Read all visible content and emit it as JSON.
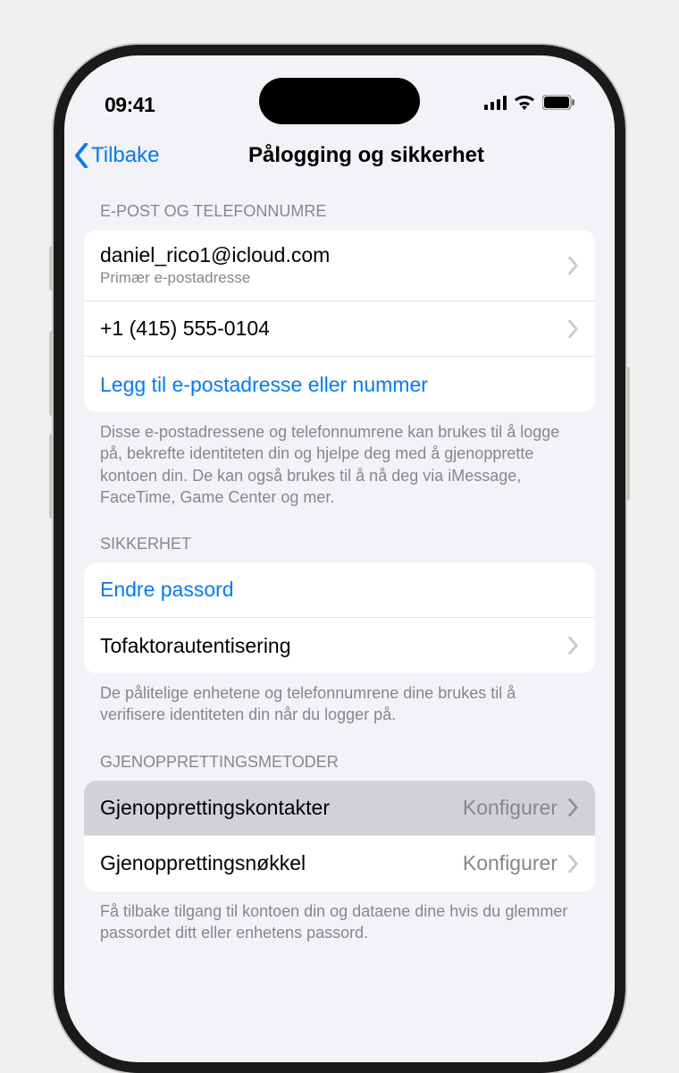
{
  "status_bar": {
    "time": "09:41"
  },
  "nav": {
    "back_label": "Tilbake",
    "title": "Pålogging og sikkerhet"
  },
  "sections": {
    "email_phone": {
      "header": "E-POST OG TELEFONNUMRE",
      "items": [
        {
          "title": "daniel_rico1@icloud.com",
          "subtitle": "Primær e-postadresse"
        },
        {
          "title": "+1 (415) 555-0104"
        }
      ],
      "add_link": "Legg til e-postadresse eller nummer",
      "footer": "Disse e-postadressene og telefonnumrene kan brukes til å logge på, bekrefte identiteten din og hjelpe deg med å gjenopprette kontoen din. De kan også brukes til å nå deg via iMessage, FaceTime, Game Center og mer."
    },
    "security": {
      "header": "SIKKERHET",
      "change_password": "Endre passord",
      "two_factor": "Tofaktorautentisering",
      "footer": "De pålitelige enhetene og telefonnumrene dine brukes til å verifisere identiteten din når du logger på."
    },
    "recovery": {
      "header": "GJENOPPRETTINGSMETODER",
      "contacts": {
        "label": "Gjenopprettingskontakter",
        "detail": "Konfigurer"
      },
      "key": {
        "label": "Gjenopprettingsnøkkel",
        "detail": "Konfigurer"
      },
      "footer": "Få tilbake tilgang til kontoen din og dataene dine hvis du glemmer passordet ditt eller enhetens passord."
    }
  }
}
